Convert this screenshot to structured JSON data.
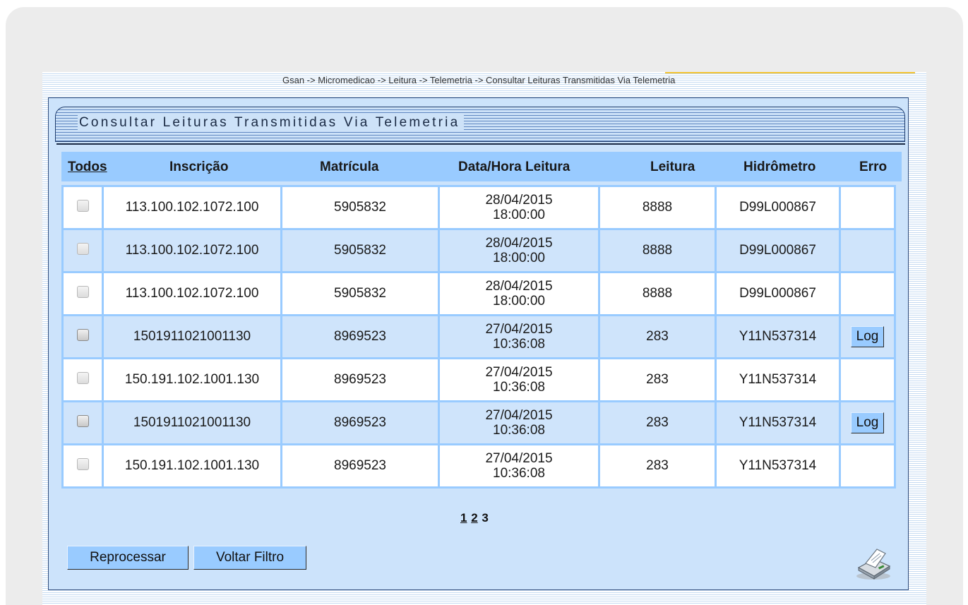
{
  "breadcrumb": "Gsan -> Micromedicao -> Leitura -> Telemetria -> Consultar Leituras Transmitidas Via Telemetria",
  "panel": {
    "title": "Consultar Leituras Transmitidas Via Telemetria"
  },
  "table": {
    "headers": {
      "todos": "Todos",
      "inscricao": "Inscrição",
      "matricula": "Matrícula",
      "data_hora": "Data/Hora Leitura",
      "leitura": "Leitura",
      "hidrometro": "Hidrômetro",
      "erro": "Erro"
    },
    "rows": [
      {
        "inscricao": "113.100.102.1072.100",
        "matricula": "5905832",
        "data": "28/04/2015",
        "hora": "18:00:00",
        "leitura": "8888",
        "hidrometro": "D99L000867",
        "erro": ""
      },
      {
        "inscricao": "113.100.102.1072.100",
        "matricula": "5905832",
        "data": "28/04/2015",
        "hora": "18:00:00",
        "leitura": "8888",
        "hidrometro": "D99L000867",
        "erro": ""
      },
      {
        "inscricao": "113.100.102.1072.100",
        "matricula": "5905832",
        "data": "28/04/2015",
        "hora": "18:00:00",
        "leitura": "8888",
        "hidrometro": "D99L000867",
        "erro": ""
      },
      {
        "inscricao": "150191102100113​0",
        "matricula": "8969523",
        "data": "27/04/2015",
        "hora": "10:36:08",
        "leitura": "283",
        "hidrometro": "Y11N537314",
        "erro": "Log"
      },
      {
        "inscricao": "150.191.102.1001.130",
        "matricula": "8969523",
        "data": "27/04/2015",
        "hora": "10:36:08",
        "leitura": "283",
        "hidrometro": "Y11N537314",
        "erro": ""
      },
      {
        "inscricao": "150191102100113​0",
        "matricula": "8969523",
        "data": "27/04/2015",
        "hora": "10:36:08",
        "leitura": "283",
        "hidrometro": "Y11N537314",
        "erro": "Log"
      },
      {
        "inscricao": "150.191.102.1001.130",
        "matricula": "8969523",
        "data": "27/04/2015",
        "hora": "10:36:08",
        "leitura": "283",
        "hidrometro": "Y11N537314",
        "erro": ""
      }
    ]
  },
  "pagination": {
    "pages": [
      "1",
      "2",
      "3"
    ],
    "current": "3"
  },
  "buttons": {
    "reprocessar": "Reprocessar",
    "voltar_filtro": "Voltar Filtro"
  },
  "icons": {
    "print": "printer-icon",
    "checkbox": "checkbox-icon"
  },
  "colors": {
    "header_bg": "#99cbff",
    "panel_bg": "#cce3fb",
    "accent": "#f4c430"
  }
}
